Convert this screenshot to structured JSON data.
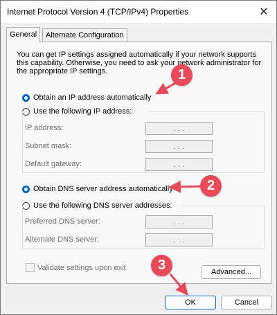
{
  "window": {
    "title": "Internet Protocol Version 4 (TCP/IPv4) Properties",
    "close_icon": "close-icon"
  },
  "tabs": [
    {
      "label": "General",
      "active": true
    },
    {
      "label": "Alternate Configuration",
      "active": false
    }
  ],
  "general": {
    "description": "You can get IP settings assigned automatically if your network supports this capability. Otherwise, you need to ask your network administrator for the appropriate IP settings.",
    "ip_auto_label": "Obtain an IP address automatically",
    "ip_manual_label": "Use the following IP address:",
    "ip_fields": [
      {
        "label": "IP address:",
        "value": ". . ."
      },
      {
        "label": "Subnet mask:",
        "value": ". . ."
      },
      {
        "label": "Default gateway:",
        "value": ". . ."
      }
    ],
    "dns_auto_label": "Obtain DNS server address automatically",
    "dns_manual_label": "Use the following DNS server addresses:",
    "dns_fields": [
      {
        "label": "Preferred DNS server:",
        "value": ". . ."
      },
      {
        "label": "Alternate DNS server:",
        "value": ". . ."
      }
    ],
    "validate_label": "Validate settings upon exit",
    "advanced_label": "Advanced..."
  },
  "buttons": {
    "ok": "OK",
    "cancel": "Cancel"
  },
  "annotations": {
    "badge_1": "1",
    "badge_2": "2",
    "badge_3": "3",
    "color": "#e94a5a"
  },
  "colors": {
    "accent": "#0067c0"
  }
}
